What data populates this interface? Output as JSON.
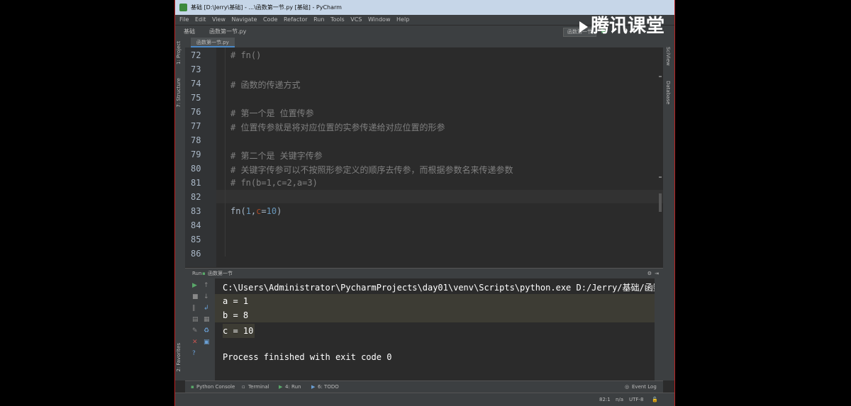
{
  "window": {
    "title": "基础 [D:\\Jerry\\基础] - ...\\函数第一节.py [基础] - PyCharm"
  },
  "brand": {
    "logo": "腾讯课堂"
  },
  "menu": [
    "File",
    "Edit",
    "View",
    "Navigate",
    "Code",
    "Refactor",
    "Run",
    "Tools",
    "VCS",
    "Window",
    "Help"
  ],
  "navbar": {
    "project": "基础",
    "file": "函数第一节.py",
    "run_config": "函数第一节"
  },
  "editor_tab": {
    "label": "函数第一节.py"
  },
  "left_tools": {
    "project": "1: Project",
    "structure": "7: Structure",
    "favorites": "2: Favorites"
  },
  "right_tools": {
    "sciview": "SciView",
    "database": "Database"
  },
  "editor": {
    "lines": [
      {
        "num": "72",
        "text": "# fn()"
      },
      {
        "num": "73",
        "text": ""
      },
      {
        "num": "74",
        "text": "# 函数的传递方式"
      },
      {
        "num": "75",
        "text": ""
      },
      {
        "num": "76",
        "text": "# 第一个是 位置传参"
      },
      {
        "num": "77",
        "text": "# 位置传参就是将对应位置的实参传递给对应位置的形参"
      },
      {
        "num": "78",
        "text": ""
      },
      {
        "num": "79",
        "text": "# 第二个是 关键字传参"
      },
      {
        "num": "80",
        "text": "# 关键字传参可以不按照形参定义的顺序去传参，而根据参数名来传递参数"
      },
      {
        "num": "81",
        "text": "# fn(b=1,c=2,a=3)"
      },
      {
        "num": "82",
        "text": ""
      },
      {
        "num": "83",
        "text": ""
      },
      {
        "num": "84",
        "text": ""
      },
      {
        "num": "85",
        "text": ""
      },
      {
        "num": "86",
        "text": ""
      }
    ],
    "call": {
      "name": "fn",
      "open": "(",
      "arg1": "1",
      "comma": ",",
      "kw": "c",
      "eq": "=",
      "arg2": "10",
      "close": ")"
    }
  },
  "run_panel": {
    "header": "Run",
    "config": "函数第一节",
    "output": [
      "C:\\Users\\Administrator\\PycharmProjects\\day01\\venv\\Scripts\\python.exe D:/Jerry/基础/函数第一节.",
      "a = 1",
      "b = 8",
      "c = 10",
      "",
      "Process finished with exit code 0"
    ]
  },
  "bottom_tabs": {
    "python_console": "Python Console",
    "terminal": "Terminal",
    "run": "4: Run",
    "todo": "6: TODO",
    "event_log": "Event Log"
  },
  "status": {
    "position": "82:1",
    "na": "n/a",
    "encoding": "UTF-8"
  }
}
